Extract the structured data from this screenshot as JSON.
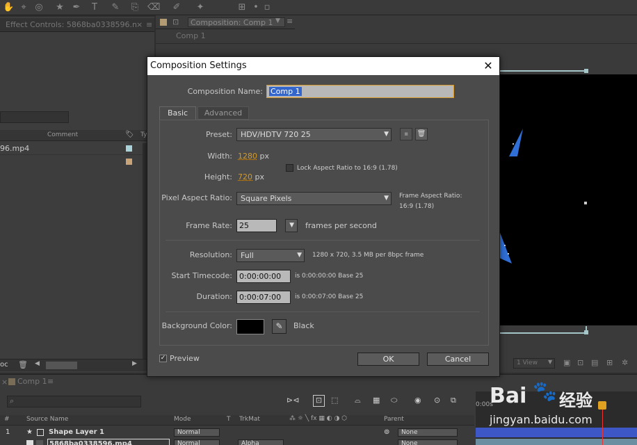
{
  "panels": {
    "effect_controls_title": "Effect Controls: 5868ba0338596.n",
    "composition_title": "Composition: Comp 1",
    "comp_breadcrumb": "Comp 1",
    "project_comment_header": "Comment",
    "project_type_header": "Ty",
    "project_item": "96.mp4",
    "timeline_tab": "Comp 1",
    "view_select": "1 View"
  },
  "dialog": {
    "title": "Composition Settings",
    "comp_name_label": "Composition Name:",
    "comp_name_value": "Comp 1",
    "tabs": [
      {
        "label": "Basic"
      },
      {
        "label": "Advanced"
      }
    ],
    "preset_label": "Preset:",
    "preset_value": "HDV/HDTV 720 25",
    "width_label": "Width:",
    "width_value": "1280",
    "height_label": "Height:",
    "height_value": "720",
    "px_unit": "px",
    "lock_aspect_label": "Lock Aspect Ratio to 16:9 (1.78)",
    "pixel_aspect_label": "Pixel Aspect Ratio:",
    "pixel_aspect_value": "Square Pixels",
    "frame_aspect_label": "Frame Aspect Ratio:",
    "frame_aspect_value": "16:9 (1.78)",
    "frame_rate_label": "Frame Rate:",
    "frame_rate_value": "25",
    "frame_rate_unit": "frames per second",
    "resolution_label": "Resolution:",
    "resolution_value": "Full",
    "resolution_info": "1280 x 720, 3.5 MB per 8bpc frame",
    "start_tc_label": "Start Timecode:",
    "start_tc_value": "0:00:00:00",
    "start_tc_info": "is 0:00:00:00  Base 25",
    "duration_label": "Duration:",
    "duration_value": "0:00:07:00",
    "duration_info": "is 0:00:07:00  Base 25",
    "bg_color_label": "Background Color:",
    "bg_color_name": "Black",
    "preview_label": "Preview",
    "ok_label": "OK",
    "cancel_label": "Cancel"
  },
  "timeline": {
    "columns": {
      "source_name": "Source Name",
      "mode": "Mode",
      "t": "T",
      "trkmat": "TrkMat",
      "parent": "Parent"
    },
    "time_marker": "0:00s",
    "layers": [
      {
        "num": "1",
        "name": "Shape Layer 1",
        "mode": "Normal",
        "trkmat": "",
        "parent": "None"
      },
      {
        "num": "2",
        "name": "5868ba0338596.mp4",
        "mode": "Normal",
        "trkmat": "Alpha",
        "parent": "None"
      }
    ],
    "row_label": "oc"
  },
  "watermark": {
    "brand_left": "Bai",
    "brand_right": "经验",
    "url": "jingyan.baidu.com"
  },
  "colors": {
    "accent": "#d39a2a",
    "viewer_bg": "#000000",
    "bg_swatch": "#000000",
    "star": "#2f6fd6"
  }
}
